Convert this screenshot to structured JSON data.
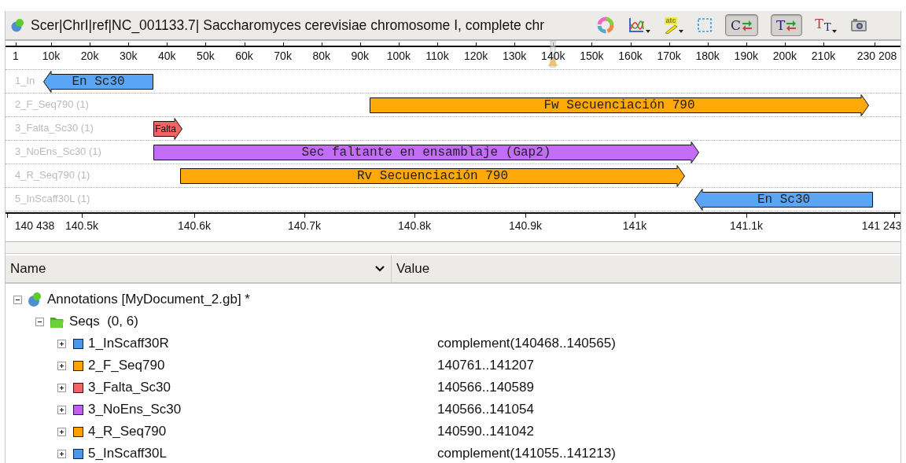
{
  "toolbar": {
    "title": "Scer|ChrI|ref|NC_001133.7| Saccharomyces cerevisiae chromosome I, complete chr",
    "tools": [
      {
        "kind": "ring"
      },
      {
        "kind": "chart",
        "menu": true
      },
      {
        "kind": "highlight",
        "glyph": "atc",
        "menu": true
      },
      {
        "kind": "select"
      },
      {
        "kind": "toggle",
        "glyph": "C",
        "pressed": true
      },
      {
        "kind": "toggle",
        "glyph": "T",
        "pressed": true
      },
      {
        "kind": "font",
        "glyphs": [
          "T",
          "T"
        ],
        "menu": true
      },
      {
        "kind": "camera"
      }
    ]
  },
  "overview_ruler": {
    "labels": [
      "1",
      "10k",
      "20k",
      "30k",
      "40k",
      "50k",
      "60k",
      "70k",
      "80k",
      "90k",
      "100k",
      "110k",
      "120k",
      "130k",
      "140k",
      "150k",
      "160k",
      "170k",
      "180k",
      "190k",
      "200k",
      "210k",
      "230 208"
    ]
  },
  "tracks": [
    {
      "label": "1_In",
      "feature": "En Sc30",
      "kind": "complement",
      "color": "#5aa6f4"
    },
    {
      "label": "2_F_Seq790 (1)",
      "feature": "Fw Secuenciación 790",
      "kind": "forward",
      "color": "#ffa80a"
    },
    {
      "label": "3_Falta_Sc30 (1)",
      "feature": "Falta",
      "kind": "forward",
      "color": "#f06464"
    },
    {
      "label": "3_NoEns_Sc30 (1)",
      "feature": "Sec faltante en ensamblaje (Gap2)",
      "kind": "forward",
      "color": "#c56cf7"
    },
    {
      "label": "4_R_Seq790 (1)",
      "feature": "Rv Secuenciación 790",
      "kind": "forward",
      "color": "#ffa80a"
    },
    {
      "label": "5_InScaff30L (1)",
      "feature": "En Sc30",
      "kind": "complement",
      "color": "#5aa6f4"
    }
  ],
  "detail_ruler": {
    "labels": [
      "140 438",
      "140.5k",
      "140.6k",
      "140.7k",
      "140.8k",
      "140.9k",
      "141k",
      "141.1k",
      "141 243"
    ]
  },
  "tree": {
    "columns": [
      "Name",
      "Value"
    ],
    "root": {
      "name": "Annotations [MyDocument_2.gb] *",
      "expanded": true,
      "children": [
        {
          "name": "Seqs  (0, 6)",
          "expanded": true,
          "children": [
            {
              "name": "1_InScaff30R",
              "value": "complement(140468..140565)",
              "color": "#4d97ea",
              "expanded": false
            },
            {
              "name": "2_F_Seq790",
              "value": "140761..141207",
              "color": "#ffa200",
              "expanded": false
            },
            {
              "name": "3_Falta_Sc30",
              "value": "140566..140589",
              "color": "#f06464",
              "expanded": false
            },
            {
              "name": "3_NoEns_Sc30",
              "value": "140566..141054",
              "color": "#c060f0",
              "expanded": false
            },
            {
              "name": "4_R_Seq790",
              "value": "140590..141042",
              "color": "#ffa200",
              "expanded": false
            },
            {
              "name": "5_InScaff30L",
              "value": "complement(141055..141213)",
              "color": "#4d97ea",
              "expanded": false
            }
          ]
        }
      ]
    }
  }
}
